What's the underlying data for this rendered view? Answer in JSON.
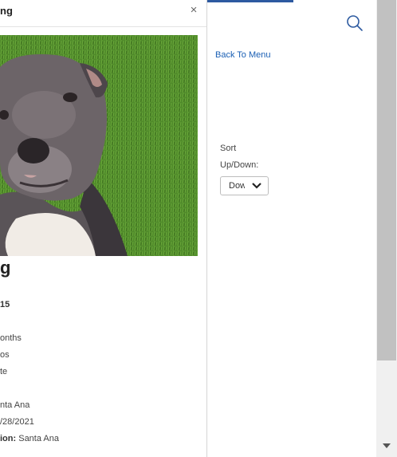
{
  "modal": {
    "title": "ng",
    "close_symbol": "×",
    "pet_name": "g",
    "details": [
      {
        "label": "",
        "value": "15",
        "bold": true
      },
      {
        "label": "",
        "value": "onths"
      },
      {
        "label": "",
        "value": "os"
      },
      {
        "label": "",
        "value": "te"
      },
      {
        "label": "",
        "value": "nta Ana"
      },
      {
        "label": "",
        "value": "/28/2021"
      },
      {
        "label": "ion:",
        "value": " Santa Ana"
      }
    ]
  },
  "nav": {
    "back_label": "Back To Menu",
    "search_icon": "search-icon"
  },
  "sort": {
    "label_line1": "Sort",
    "label_line2": "Up/Down:",
    "selected": "Down"
  },
  "colors": {
    "accent": "#2d5aa0",
    "link": "#1a5fb4",
    "grass": "#4f8a2a"
  }
}
